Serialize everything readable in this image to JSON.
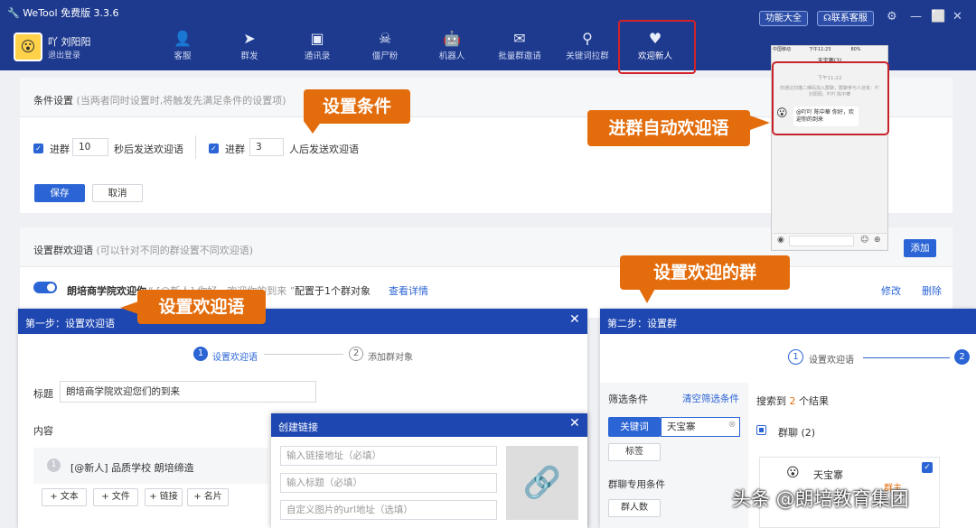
{
  "app": {
    "title": "WeTool 免费版 3.3.6"
  },
  "toolbar": {
    "features": "功能大全",
    "support": "联系客服"
  },
  "user": {
    "name": "吖 刘阳阳",
    "logout": "退出登录",
    "avatar": "😮"
  },
  "nav": [
    {
      "label": "客服",
      "icon": "person-icon",
      "glyph": "👤"
    },
    {
      "label": "群发",
      "icon": "send-icon",
      "glyph": "➤"
    },
    {
      "label": "通讯录",
      "icon": "contacts-icon",
      "glyph": "▣"
    },
    {
      "label": "僵尸粉",
      "icon": "skull-icon",
      "glyph": "☠"
    },
    {
      "label": "机器人",
      "icon": "robot-icon",
      "glyph": "🤖"
    },
    {
      "label": "批量群邀请",
      "icon": "mail-icon",
      "glyph": "✉"
    },
    {
      "label": "关键词拉群",
      "icon": "search-icon",
      "glyph": "⚲"
    },
    {
      "label": "欢迎新人",
      "icon": "heart-icon",
      "glyph": "♥"
    }
  ],
  "conditions": {
    "title": "条件设置",
    "hint": "(当两者同时设置时,将触发先满足条件的设置项)",
    "c1_prefix": "进群",
    "c1_value": "10",
    "c1_suffix": "秒后发送欢迎语",
    "c2_prefix": "进群",
    "c2_value": "3",
    "c2_suffix": "人后发送欢迎语",
    "save": "保存",
    "cancel": "取消"
  },
  "welcome_groups": {
    "title": "设置群欢迎语",
    "hint": "(可以针对不同的群设置不同欢迎语)",
    "add": "添加",
    "row_name": "朗培商学院欢迎你",
    "row_preview": "“ [@新人] 你好，欢迎你的到来 ”",
    "row_config": "配置于1个群对象",
    "row_view": "查看详情",
    "row_edit": "修改",
    "row_delete": "删除"
  },
  "callouts": {
    "set_condition": "设置条件",
    "auto_welcome": "进群自动欢迎语",
    "set_group": "设置欢迎的群",
    "set_message": "设置欢迎语"
  },
  "phone": {
    "status_left": "中国移动",
    "status_time": "下午11:23",
    "status_battery": "80%",
    "chat_title": "天宝寨(3)",
    "msg_time": "下午11:22",
    "system_msg": "你通过扫描二维码加入群聊，群聊参与人还有：吖 刘阳阳、吖吖 陈中華",
    "bubble": "@吖吖 陈中華 你好，欢迎你的到来"
  },
  "dialog1": {
    "title": "第一步：设置欢迎语",
    "step1_num": "1",
    "step1": "设置欢迎语",
    "step2_num": "2",
    "step2": "添加群对象",
    "label_title": "标题",
    "title_value": "朗培商学院欢迎您们的到来",
    "label_content": "内容",
    "item_num": "1",
    "item_text": "[@新人] 品质学校 朗培缔造",
    "add_text": "+ 文本",
    "add_file": "+ 文件",
    "add_link": "+ 链接",
    "add_card": "+ 名片"
  },
  "dialog_link": {
    "title": "创建链接",
    "url_placeholder": "输入链接地址（必填）",
    "title_placeholder": "输入标题（必填）",
    "img_placeholder": "自定义图片的url地址（选填）"
  },
  "dialog2": {
    "title": "第二步：设置群",
    "step1_num": "1",
    "step1": "设置欢迎语",
    "step2_num": "2",
    "filter_label": "筛选条件",
    "clear_filter": "清空筛选条件",
    "keyword_tab": "关键词",
    "keyword_value": "天宝寨",
    "tag_btn": "标签",
    "special_label": "群聊专用条件",
    "member_btn": "群人数",
    "result_prefix": "搜索到",
    "result_count": "2",
    "result_suffix": "个结果",
    "group_label": "群聊",
    "group_count": "(2)",
    "group_item": "天宝寨",
    "group_badge": "群主"
  },
  "watermark": "头条 @朗培教育集团",
  "colors": {
    "header": "#1e3a8f",
    "accent": "#2b64d4",
    "callout": "#e36d0d",
    "highlight": "#c8232a"
  }
}
